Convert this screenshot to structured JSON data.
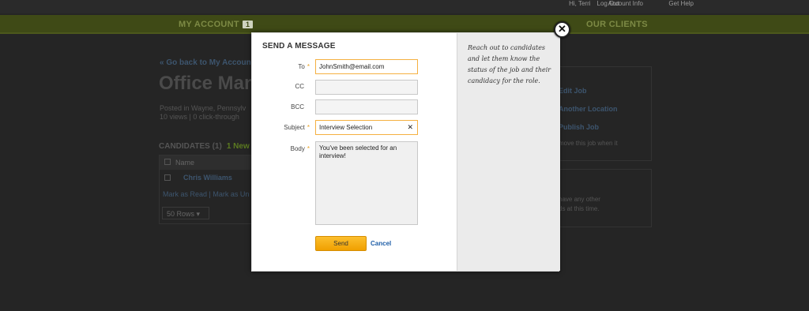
{
  "background": {
    "top_links": [
      "Hi, Terri",
      "Log Out",
      "Account Info",
      "Get Help"
    ],
    "nav": {
      "my_account": "MY ACCOUNT",
      "my_account_badge": "1",
      "our_clients": "OUR CLIENTS"
    },
    "back_link": "« Go back to My Account",
    "job_title": "Office Manag",
    "meta_line1": "Posted in Wayne, Pennsylv",
    "meta_line2": "10 views | 0 click-through",
    "candidates_label": "CANDIDATES (1)",
    "candidates_new": "1 New",
    "table_header": "Name",
    "candidate_name": "Chris Williams",
    "mark_links": "Mark as Read | Mark as Un",
    "rows_select": "50 Rows",
    "side_actions": [
      "Edit Job",
      "Another Location",
      "Publish Job"
    ],
    "side_note": "move this job when it",
    "side_note2": "have any other",
    "side_note3": "ds at this time."
  },
  "modal": {
    "title": "SEND A MESSAGE",
    "fields": {
      "to_label": "To",
      "to_value": "JohnSmith@email.com",
      "cc_label": "CC",
      "cc_value": "",
      "bcc_label": "BCC",
      "bcc_value": "",
      "subject_label": "Subject",
      "subject_value": "Interview Selection",
      "body_label": "Body",
      "body_value": "You've been selected for an interview!"
    },
    "send_label": "Send",
    "cancel_label": "Cancel",
    "tip": "Reach out to candidates and let them know the status of the job and their candidacy for the role.",
    "close_glyph": "✕"
  },
  "colors": {
    "accent": "#f5b041",
    "link": "#1f5fa8",
    "nav_bg": "#3f4a16"
  }
}
